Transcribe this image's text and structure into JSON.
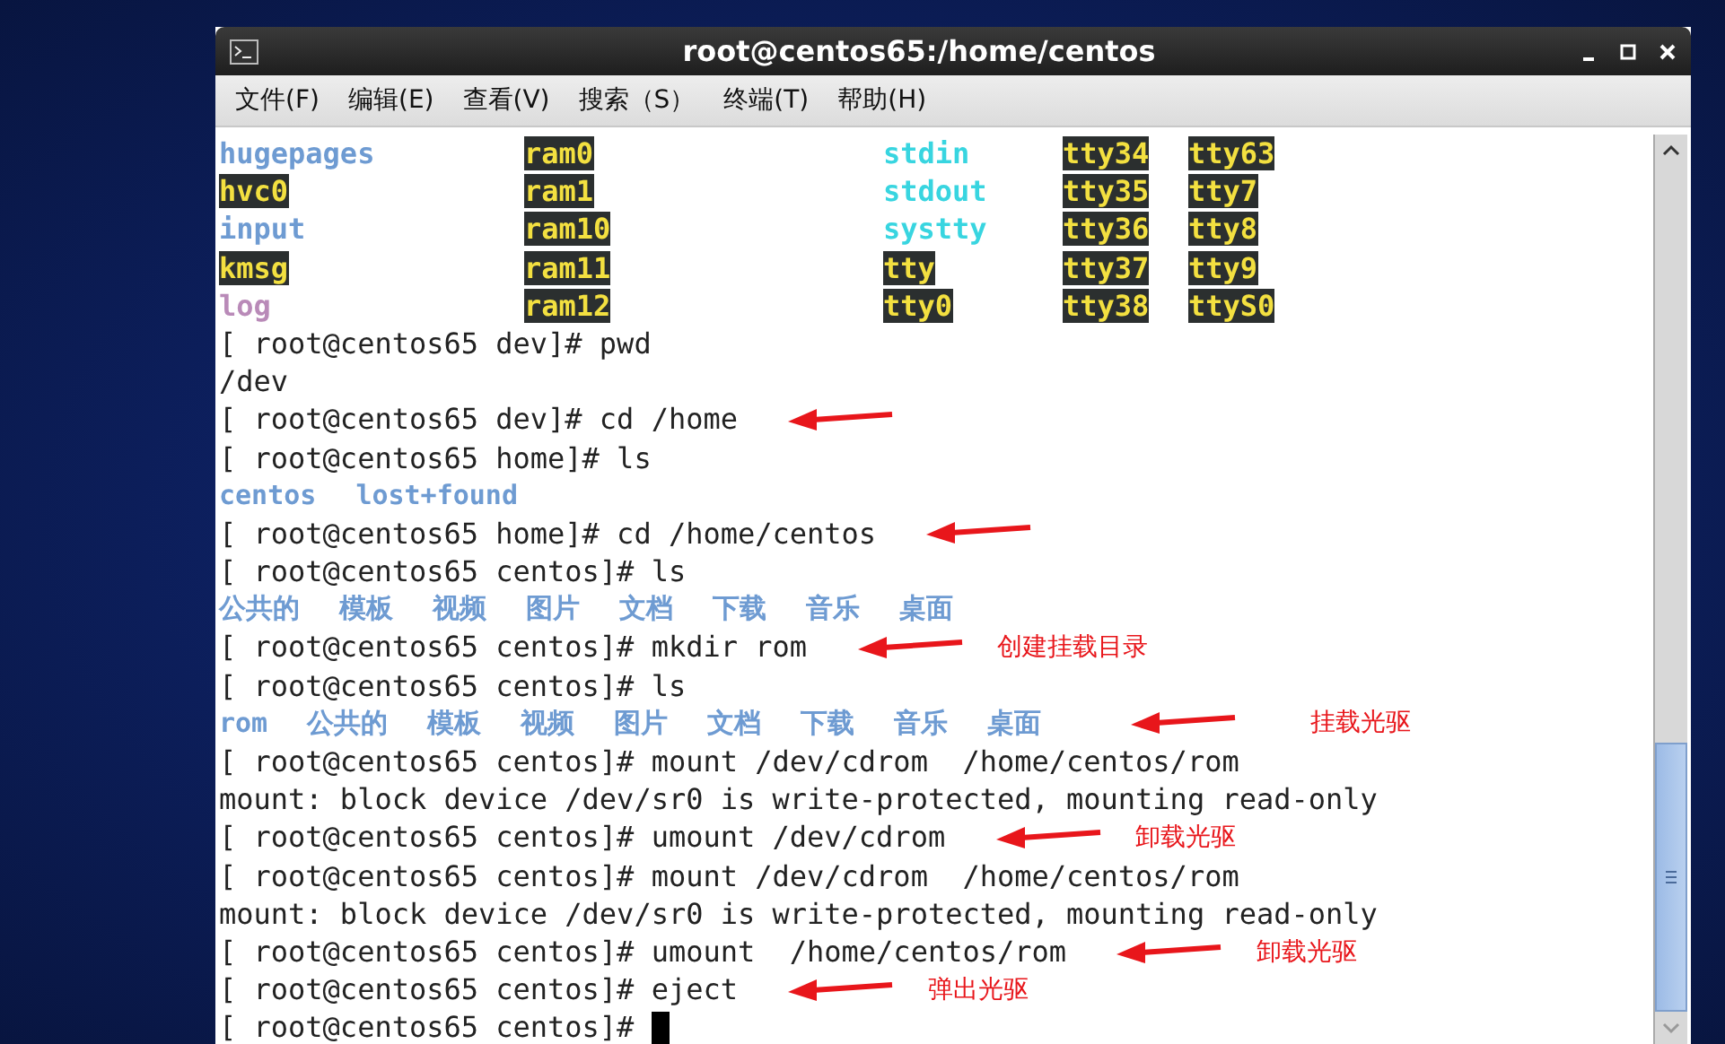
{
  "window": {
    "title": "root@centos65:/home/centos"
  },
  "menu": [
    {
      "label": "文件(F)"
    },
    {
      "label": "编辑(E)"
    },
    {
      "label": "查看(V)"
    },
    {
      "label": "搜索（S）"
    },
    {
      "label": "终端(T)"
    },
    {
      "label": "帮助(H)"
    }
  ],
  "terminal": {
    "lines": [
      {
        "kind": "columns",
        "cells": [
          {
            "text": "hugepages",
            "kind": "dir"
          },
          {
            "text": "ram0",
            "kind": "device"
          },
          {
            "text": "stdin",
            "kind": "link"
          },
          {
            "text": "tty34",
            "kind": "device"
          },
          {
            "text": "tty63",
            "kind": "device"
          }
        ]
      },
      {
        "kind": "columns",
        "cells": [
          {
            "text": "hvc0",
            "kind": "device"
          },
          {
            "text": "ram1",
            "kind": "device"
          },
          {
            "text": "stdout",
            "kind": "link"
          },
          {
            "text": "tty35",
            "kind": "device"
          },
          {
            "text": "tty7",
            "kind": "device"
          }
        ]
      },
      {
        "kind": "columns",
        "cells": [
          {
            "text": "input",
            "kind": "dir"
          },
          {
            "text": "ram10",
            "kind": "device"
          },
          {
            "text": "systty",
            "kind": "link"
          },
          {
            "text": "tty36",
            "kind": "device"
          },
          {
            "text": "tty8",
            "kind": "device"
          }
        ]
      },
      {
        "kind": "columns",
        "cells": [
          {
            "text": "kmsg",
            "kind": "device"
          },
          {
            "text": "ram11",
            "kind": "device"
          },
          {
            "text": "tty",
            "kind": "device"
          },
          {
            "text": "tty37",
            "kind": "device"
          },
          {
            "text": "tty9",
            "kind": "device"
          }
        ]
      },
      {
        "kind": "columns",
        "cells": [
          {
            "text": "log",
            "kind": "socket"
          },
          {
            "text": "ram12",
            "kind": "device"
          },
          {
            "text": "tty0",
            "kind": "device"
          },
          {
            "text": "tty38",
            "kind": "device"
          },
          {
            "text": "ttyS0",
            "kind": "device"
          }
        ]
      },
      {
        "kind": "text",
        "text": "[ root@centos65 dev]# pwd"
      },
      {
        "kind": "text",
        "text": "/dev"
      },
      {
        "kind": "text",
        "text": "[ root@centos65 dev]# cd /home",
        "arrow": true
      },
      {
        "kind": "text",
        "text": "[ root@centos65 home]# ls"
      },
      {
        "kind": "names",
        "items": [
          "centos",
          "lost+found"
        ]
      },
      {
        "kind": "text",
        "text": "[ root@centos65 home]# cd /home/centos",
        "arrow": true
      },
      {
        "kind": "text",
        "text": "[ root@centos65 centos]# ls"
      },
      {
        "kind": "names",
        "items": [
          "公共的",
          "模板",
          "视频",
          "图片",
          "文档",
          "下载",
          "音乐",
          "桌面"
        ]
      },
      {
        "kind": "text",
        "text": "[ root@centos65 centos]# mkdir rom",
        "arrow": true,
        "note": "创建挂载目录"
      },
      {
        "kind": "text",
        "text": "[ root@centos65 centos]# ls"
      },
      {
        "kind": "names",
        "items": [
          "rom",
          "公共的",
          "模板",
          "视频",
          "图片",
          "文档",
          "下载",
          "音乐",
          "桌面"
        ],
        "arrow": true,
        "note": "挂载光驱"
      },
      {
        "kind": "text",
        "text": "[ root@centos65 centos]# mount /dev/cdrom  /home/centos/rom"
      },
      {
        "kind": "text",
        "text": "mount: block device /dev/sr0 is write-protected, mounting read-only"
      },
      {
        "kind": "text",
        "text": "[ root@centos65 centos]# umount /dev/cdrom",
        "arrow": true,
        "note": "卸载光驱"
      },
      {
        "kind": "text",
        "text": "[ root@centos65 centos]# mount /dev/cdrom  /home/centos/rom"
      },
      {
        "kind": "text",
        "text": "mount: block device /dev/sr0 is write-protected, mounting read-only"
      },
      {
        "kind": "text",
        "text": "[ root@centos65 centos]# umount  /home/centos/rom",
        "arrow": true,
        "note": "卸载光驱"
      },
      {
        "kind": "text",
        "text": "[ root@centos65 centos]# eject",
        "arrow": true,
        "note": "弹出光驱"
      },
      {
        "kind": "text",
        "text": "[ root@centos65 centos]# ",
        "cursor": true
      }
    ]
  }
}
